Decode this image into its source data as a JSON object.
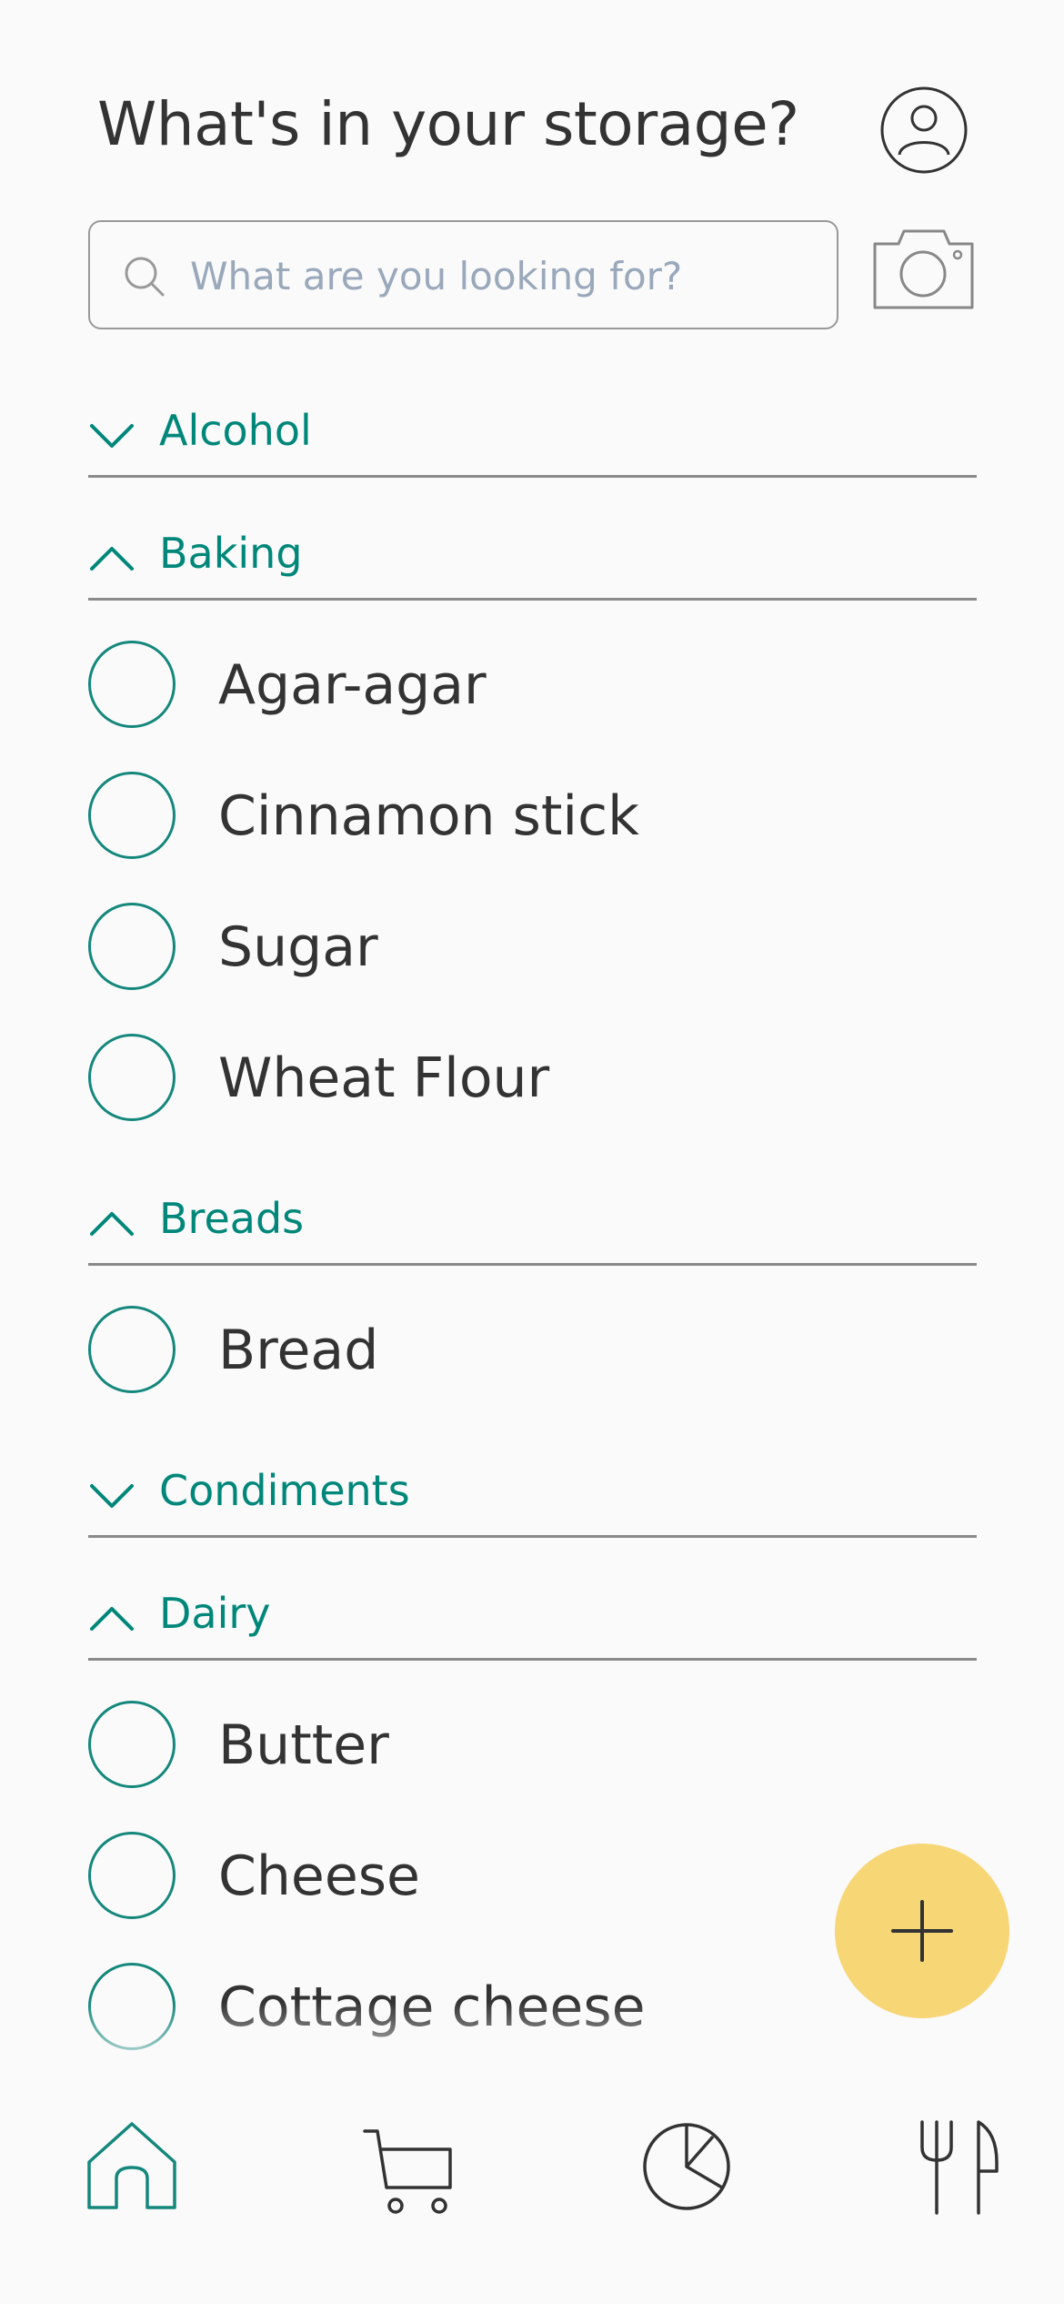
{
  "header": {
    "title": "What's in your storage?",
    "profile_icon": "person-circle-icon",
    "camera_icon": "camera-icon"
  },
  "search": {
    "placeholder": "What are you looking for?",
    "value": "",
    "icon": "search-icon"
  },
  "categories": [
    {
      "label": "Alcohol",
      "expanded": false,
      "items": []
    },
    {
      "label": "Baking",
      "expanded": true,
      "items": [
        "Agar-agar",
        "Cinnamon stick",
        "Sugar",
        "Wheat Flour"
      ]
    },
    {
      "label": "Breads",
      "expanded": true,
      "items": [
        "Bread"
      ]
    },
    {
      "label": "Condiments",
      "expanded": false,
      "items": []
    },
    {
      "label": "Dairy",
      "expanded": true,
      "items": [
        "Butter",
        "Cheese",
        "Cottage cheese"
      ]
    }
  ],
  "fab": {
    "icon": "plus-icon",
    "color": "#f7d676"
  },
  "nav": {
    "items": [
      {
        "icon": "home-icon",
        "active": true
      },
      {
        "icon": "cart-icon",
        "active": false
      },
      {
        "icon": "pie-chart-icon",
        "active": false
      },
      {
        "icon": "fork-knife-icon",
        "active": false
      }
    ]
  },
  "colors": {
    "accent": "#00877a",
    "text": "#333333",
    "fab": "#f7d676",
    "placeholder": "#9aa8bb"
  }
}
